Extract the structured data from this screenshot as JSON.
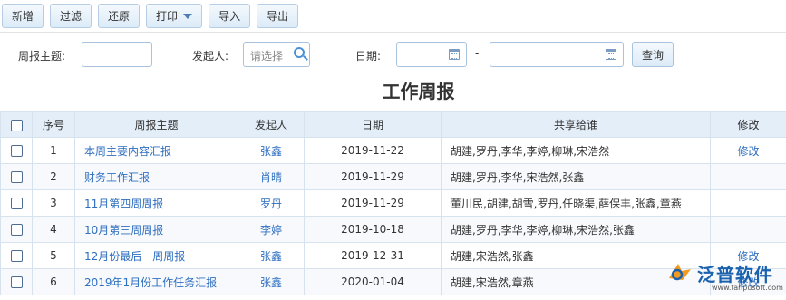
{
  "toolbar": {
    "buttons": [
      "新增",
      "过滤",
      "还原",
      "打印",
      "导入",
      "导出"
    ]
  },
  "search": {
    "topic_label": "周报主题:",
    "topic_value": "",
    "initiator_label": "发起人:",
    "initiator_placeholder": "请选择",
    "date_label": "日期:",
    "date_separator": "-",
    "query_button": "查询"
  },
  "page_title": "工作周报",
  "table": {
    "headers": [
      "",
      "序号",
      "周报主题",
      "发起人",
      "日期",
      "共享给谁",
      "修改"
    ],
    "rows": [
      {
        "no": "1",
        "topic": "本周主要内容汇报",
        "initiator": "张鑫",
        "date": "2019-11-22",
        "share": "胡建,罗丹,李华,李婷,柳琳,宋浩然",
        "edit": "修改"
      },
      {
        "no": "2",
        "topic": "财务工作汇报",
        "initiator": "肖晴",
        "date": "2019-11-29",
        "share": "胡建,罗丹,李华,宋浩然,张鑫",
        "edit": ""
      },
      {
        "no": "3",
        "topic": "11月第四周周报",
        "initiator": "罗丹",
        "date": "2019-11-29",
        "share": "董川民,胡建,胡雪,罗丹,任晓渠,薛保丰,张鑫,章燕",
        "edit": ""
      },
      {
        "no": "4",
        "topic": "10月第三周周报",
        "initiator": "李婷",
        "date": "2019-10-18",
        "share": "胡建,罗丹,李华,李婷,柳琳,宋浩然,张鑫",
        "edit": ""
      },
      {
        "no": "5",
        "topic": "12月份最后一周周报",
        "initiator": "张鑫",
        "date": "2019-12-31",
        "share": "胡建,宋浩然,张鑫",
        "edit": "修改"
      },
      {
        "no": "6",
        "topic": "2019年1月份工作任务汇报",
        "initiator": "张鑫",
        "date": "2020-01-04",
        "share": "胡建,宋浩然,章燕",
        "edit": "修改"
      }
    ]
  },
  "watermark": {
    "brand": "泛普软件",
    "url": "www.fanpusoft.com"
  },
  "colors": {
    "link": "#2f6fc0",
    "header_bg": "#e3eef9",
    "button_border": "#b7cde3"
  }
}
